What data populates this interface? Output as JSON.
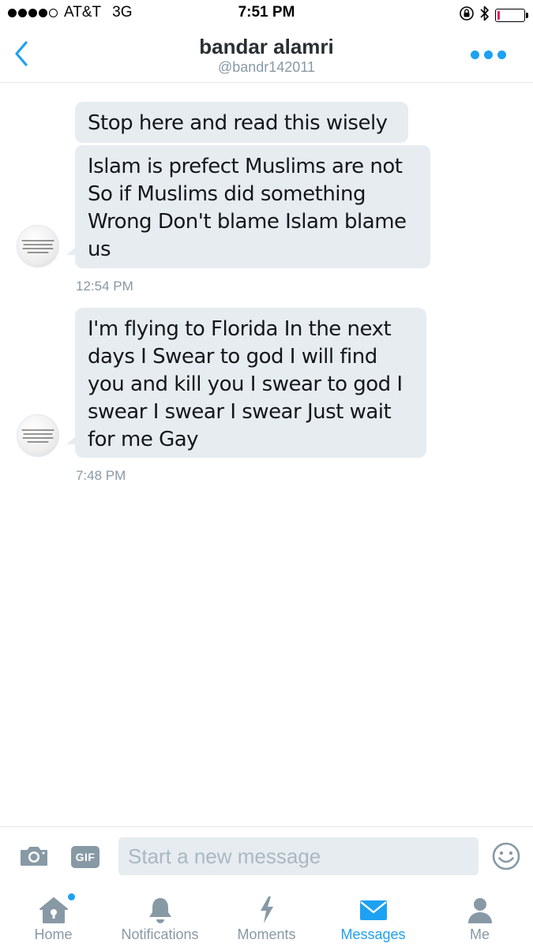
{
  "status_bar": {
    "carrier": "AT&T",
    "network": "3G",
    "time": "7:51 PM",
    "signal_bars_filled": 4,
    "signal_bars_total": 5,
    "battery_level": 0.1,
    "battery_color": "#e0245e"
  },
  "header": {
    "name": "bandar alamri",
    "handle": "@bandr142011",
    "back_icon": "chevron-left-icon",
    "more_icon": "more-dots-icon",
    "accent": "#1da1f2"
  },
  "messages": [
    {
      "bubbles": [
        "Stop here and read this wisely",
        "Islam is prefect Muslims are not So if Muslims did something Wrong Don't blame Islam blame us"
      ],
      "timestamp": "12:54 PM"
    },
    {
      "bubbles": [
        "I'm flying  to Florida In the next days  I Swear to god I will find you and kill you I swear to god I swear I swear I swear Just wait for me Gay"
      ],
      "timestamp": "7:48 PM"
    }
  ],
  "composer": {
    "placeholder": "Start a new message",
    "gif_label": "GIF",
    "camera_icon": "camera-icon",
    "emoji_icon": "smiley-icon"
  },
  "tabs": [
    {
      "label": "Home",
      "icon": "home-icon",
      "active": false,
      "has_dot": true
    },
    {
      "label": "Notifications",
      "icon": "bell-icon",
      "active": false,
      "has_dot": false
    },
    {
      "label": "Moments",
      "icon": "lightning-icon",
      "active": false,
      "has_dot": false
    },
    {
      "label": "Messages",
      "icon": "envelope-icon",
      "active": true,
      "has_dot": false
    },
    {
      "label": "Me",
      "icon": "person-icon",
      "active": false,
      "has_dot": false
    }
  ]
}
